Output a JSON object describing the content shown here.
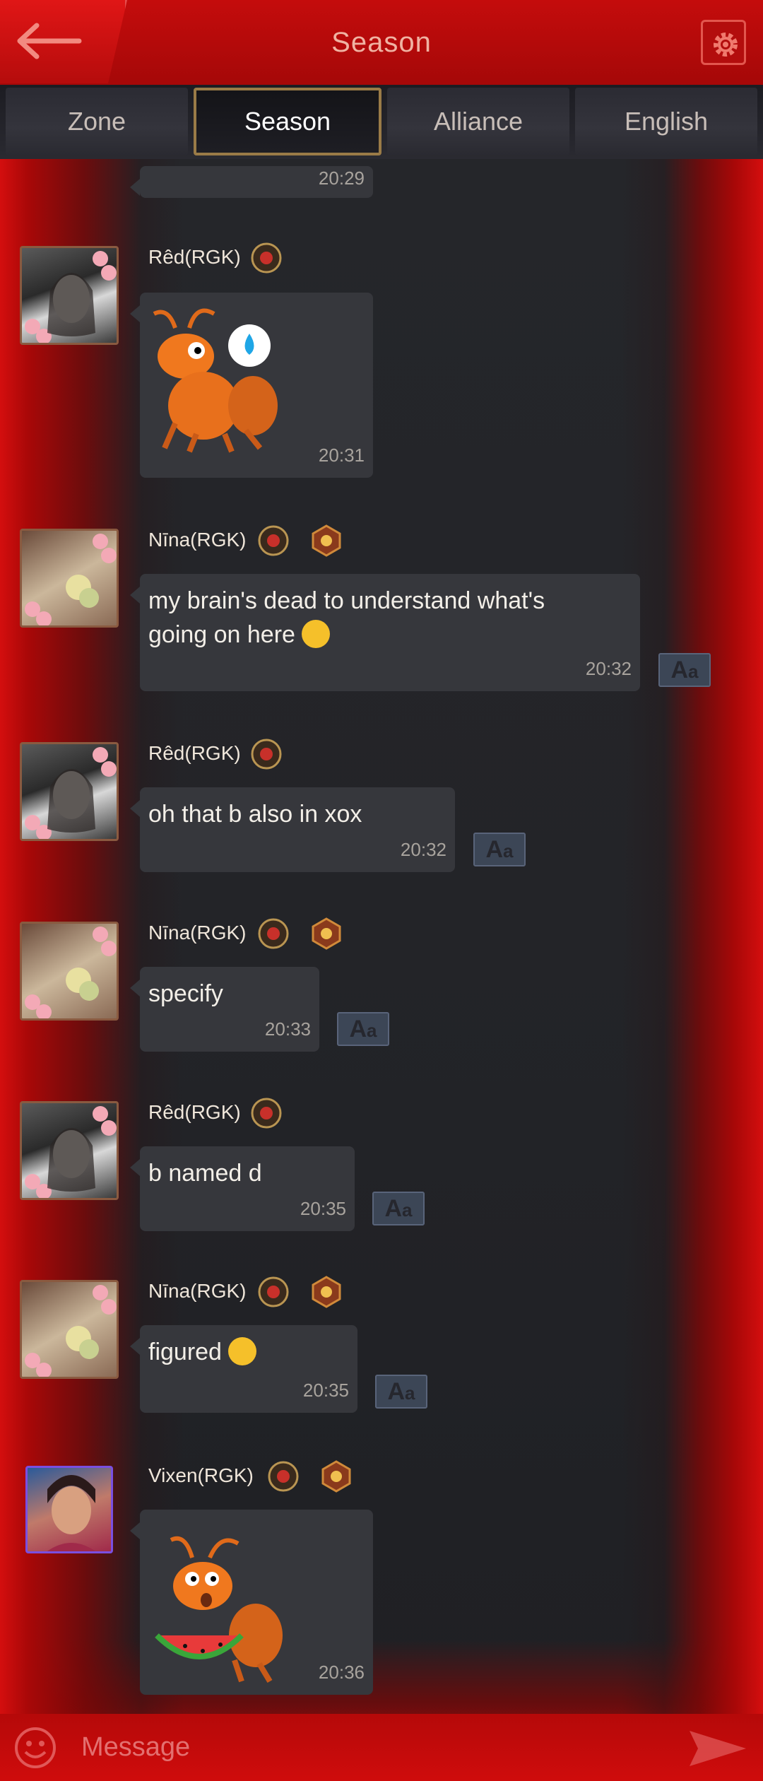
{
  "header": {
    "title": "Season"
  },
  "tabs": [
    {
      "label": "Zone",
      "active": false
    },
    {
      "label": "Season",
      "active": true
    },
    {
      "label": "Alliance",
      "active": false
    },
    {
      "label": "English",
      "active": false
    }
  ],
  "messages": [
    {
      "user": "",
      "time": "20:29",
      "type": "partial"
    },
    {
      "user": "Rêd(RGK)",
      "time": "20:31",
      "type": "sticker",
      "sticker": "ant-sweat-sticker"
    },
    {
      "user": "Nīna(RGK)",
      "text_line1": "my brain's dead to understand what's",
      "text_line2": " going on here",
      "time": "20:32",
      "type": "text"
    },
    {
      "user": "Rêd(RGK)",
      "text": "oh that b also in xox",
      "time": "20:32",
      "type": "text"
    },
    {
      "user": "Nīna(RGK)",
      "text": "specify",
      "time": "20:33",
      "type": "text"
    },
    {
      "user": "Rêd(RGK)",
      "text": "b named d",
      "time": "20:35",
      "type": "text"
    },
    {
      "user": "Nīna(RGK)",
      "text": "figured",
      "time": "20:35",
      "type": "text"
    },
    {
      "user": "Vixen(RGK)",
      "time": "20:36",
      "type": "sticker",
      "sticker": "ant-watermelon-sticker"
    }
  ],
  "translate": {
    "upper": "A",
    "lower": "a"
  },
  "input": {
    "placeholder": "Message"
  },
  "colors": {
    "frame_red": "#c40c0c",
    "bubble": "#36373c",
    "tab_active_border": "#9a7b47"
  }
}
